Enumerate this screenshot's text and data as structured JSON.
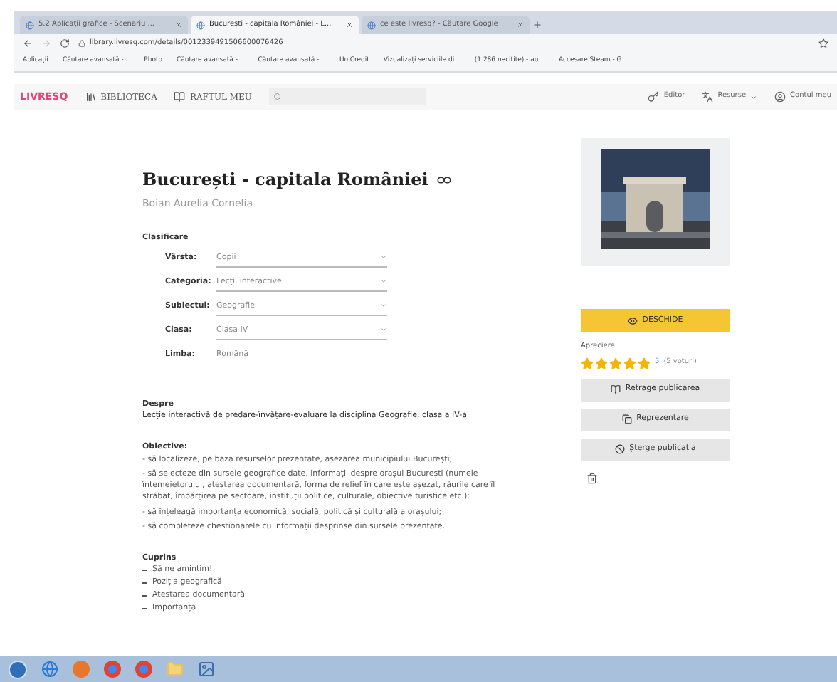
{
  "browser": {
    "tabs": [
      {
        "title": "5.2 Aplicații grafice - Scenariu ...",
        "selected": false
      },
      {
        "title": "București - capitala României - L...",
        "selected": true
      },
      {
        "title": "ce este livresq? - Căutare Google",
        "selected": false
      }
    ],
    "url": "library.livresq.com/details/0012339491506600076426",
    "bookmarks": [
      "Aplicații",
      "Căutare avansată -...",
      "Photo",
      "Căutare avansată -...",
      "Căutare avansată -...",
      "UniCredit",
      "Vizualizați serviciile di...",
      "(1.286 necitite) - au...",
      "Accesare Steam - G..."
    ]
  },
  "site_header": {
    "logo": "LIVRESQ",
    "nav": [
      "BIBLIOTECA",
      "RAFTUL MEU"
    ],
    "actions": [
      "Editor",
      "Resurse",
      "Contul meu"
    ]
  },
  "lesson": {
    "title": "București - capitala României",
    "author": "Boian Aurelia Cornelia",
    "classification_title": "Clasificare",
    "fields": [
      {
        "label": "Vârsta:",
        "value": "Copii",
        "kind": "select"
      },
      {
        "label": "Categoria:",
        "value": "Lecții interactive",
        "kind": "select"
      },
      {
        "label": "Subiectul:",
        "value": "Geografie",
        "kind": "select"
      },
      {
        "label": "Clasa:",
        "value": "Clasa IV",
        "kind": "select"
      },
      {
        "label": "Limba:",
        "value": "Română",
        "kind": "text"
      }
    ],
    "about_title": "Despre",
    "about": "Lecție interactivă de predare-învățare-evaluare la disciplina Geografie, clasa a IV-a",
    "objectives_title": "Obiective:",
    "objectives": [
      "- să localizeze, pe baza resurselor prezentate, așezarea municipiului București;",
      "- să selecteze din sursele geografice date, informații despre orașul București (numele întemeietorului, atestarea documentară, forma de relief în care este așezat, râurile care îl străbat, împărțirea pe sectoare, instituții politice, culturale, obiective turistice etc.);",
      "- să înțeleagă importanța economică, socială, politică și culturală a orașului;",
      "- să completeze chestionarele cu informații desprinse din sursele prezentate."
    ],
    "contents_title": "Cuprins",
    "contents": [
      "Să ne amintim!",
      "Poziția geografică",
      "Atestarea documentară",
      "Importanța"
    ]
  },
  "sidebar": {
    "open_button": "DESCHIDE",
    "rating_label": "Apreciere",
    "stars": 5,
    "rating_count": "5",
    "votes": "(5 voturi)",
    "buttons": [
      "Retrage publicarea",
      "Reprezentare",
      "Șterge publicația"
    ]
  }
}
